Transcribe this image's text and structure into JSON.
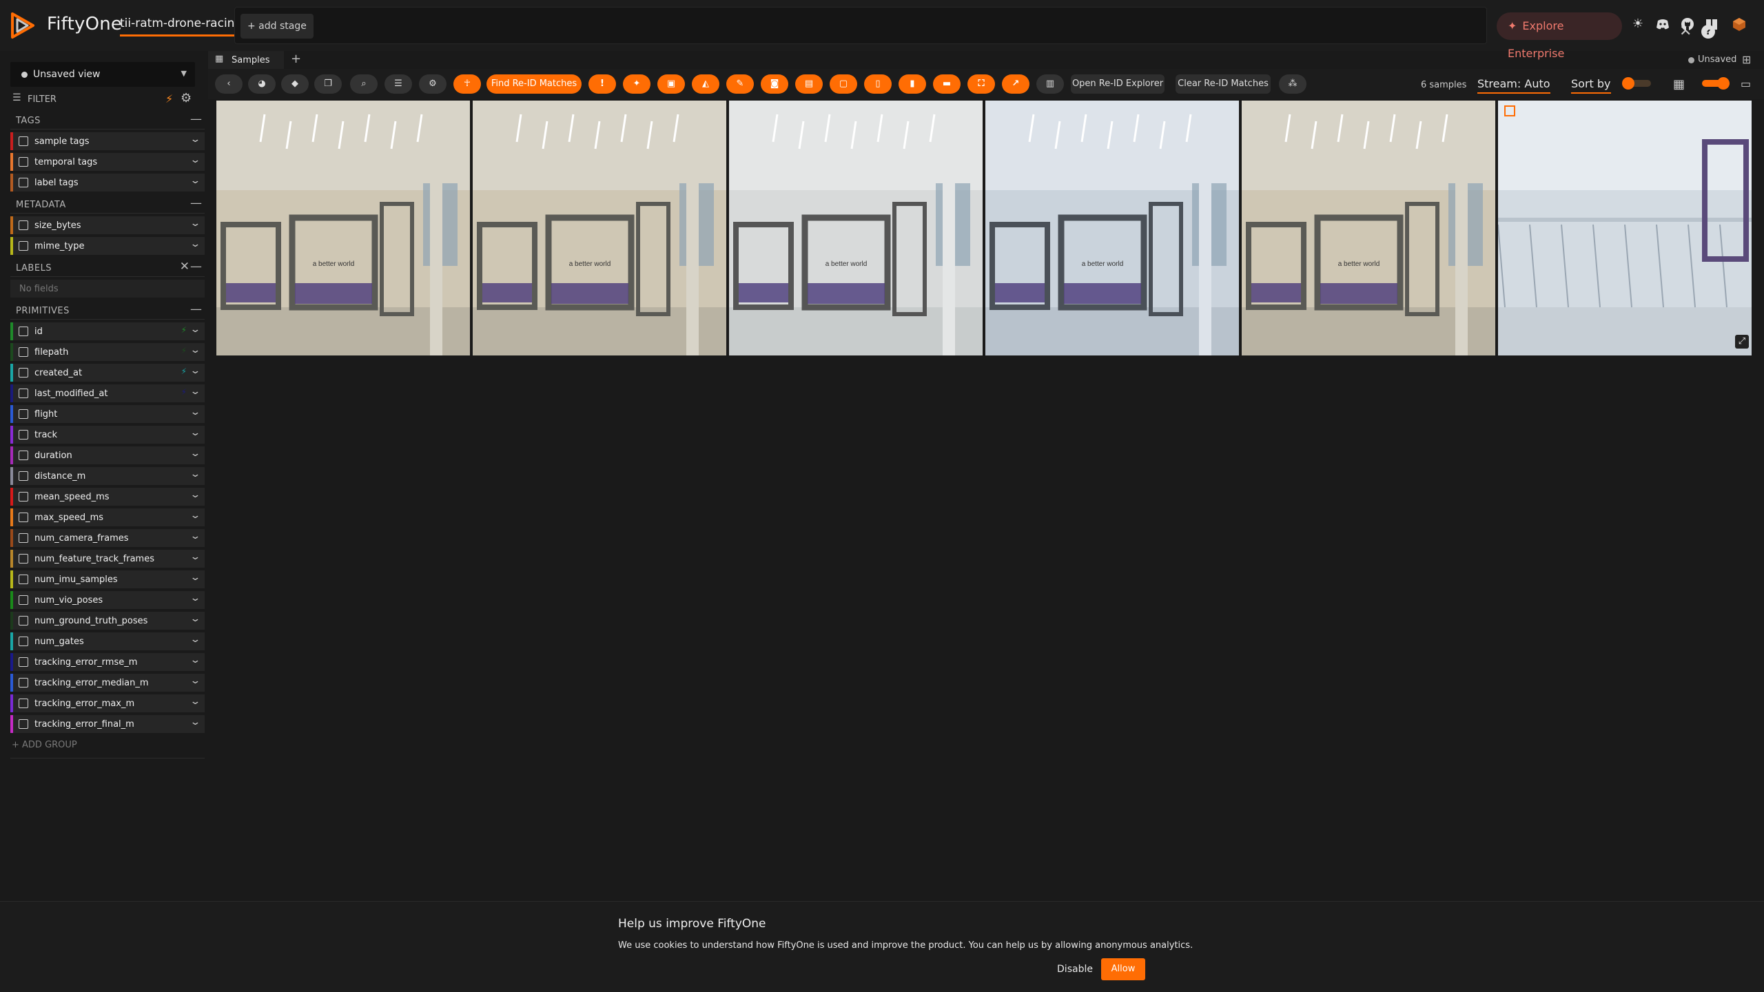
{
  "app": {
    "brand": "FiftyOne",
    "dataset_name": "tii-ratm-drone-racing",
    "add_stage": "+ add stage",
    "explore_enterprise": "Explore Enterprise",
    "accent_color": "#ff6d04"
  },
  "sidebar": {
    "view_select": "Unsaved view",
    "filter_label": "FILTER",
    "groups": {
      "tags": "TAGS",
      "metadata": "METADATA",
      "labels": "LABELS",
      "primitives": "PRIMITIVES"
    },
    "tags_fields": [
      {
        "label": "sample tags",
        "color": "#c81e1e"
      },
      {
        "label": "temporal tags",
        "color": "#e8772e"
      },
      {
        "label": "label tags",
        "color": "#b35b22"
      }
    ],
    "metadata_fields": [
      {
        "label": "size_bytes",
        "color": "#c06a1a"
      },
      {
        "label": "mime_type",
        "color": "#b8b81a"
      }
    ],
    "labels_empty": "No fields",
    "primitive_fields": [
      {
        "label": "id",
        "color": "#1f8a2a"
      },
      {
        "label": "filepath",
        "color": "#1d4a1f"
      },
      {
        "label": "created_at",
        "color": "#1aa6a6"
      },
      {
        "label": "last_modified_at",
        "color": "#1a1a7a"
      },
      {
        "label": "flight",
        "color": "#2a5ad6"
      },
      {
        "label": "track",
        "color": "#8a2ad6"
      },
      {
        "label": "duration",
        "color": "#a62ab8"
      },
      {
        "label": "distance_m",
        "color": "#8a8a9a"
      },
      {
        "label": "mean_speed_ms",
        "color": "#d61a1a"
      },
      {
        "label": "max_speed_ms",
        "color": "#e87a1a"
      },
      {
        "label": "num_camera_frames",
        "color": "#9a4a1a"
      },
      {
        "label": "num_feature_track_frames",
        "color": "#b8862a"
      },
      {
        "label": "num_imu_samples",
        "color": "#b8b81a"
      },
      {
        "label": "num_vio_poses",
        "color": "#1a8a1a"
      },
      {
        "label": "num_ground_truth_poses",
        "color": "#1d3a1d"
      },
      {
        "label": "num_gates",
        "color": "#1aa6a6"
      },
      {
        "label": "tracking_error_rmse_m",
        "color": "#1a1a8a"
      },
      {
        "label": "tracking_error_median_m",
        "color": "#2a5ad6"
      },
      {
        "label": "tracking_error_max_m",
        "color": "#7a2ad6"
      },
      {
        "label": "tracking_error_final_m",
        "color": "#c62ac6"
      }
    ],
    "add_group": "+ ADD GROUP"
  },
  "tabs": {
    "samples": "Samples",
    "unsaved": "Unsaved"
  },
  "toolbar": {
    "find_reid": "Find Re-ID Matches",
    "open_reid": "Open Re-ID Explorer",
    "clear_reid": "Clear Re-ID Matches",
    "sample_count": "6 samples",
    "stream": "Stream: Auto",
    "sort_by": "Sort by"
  },
  "grid": {
    "tiles": [
      {
        "name": "sample-tile-1",
        "tone": "warm"
      },
      {
        "name": "sample-tile-2",
        "tone": "warm"
      },
      {
        "name": "sample-tile-3",
        "tone": "neutral"
      },
      {
        "name": "sample-tile-4",
        "tone": "cool"
      },
      {
        "name": "sample-tile-5",
        "tone": "warm"
      },
      {
        "name": "sample-tile-6",
        "tone": "wall"
      }
    ],
    "gate_text": "a better world"
  },
  "cookie": {
    "title": "Help us improve FiftyOne",
    "text": "We use cookies to understand how FiftyOne is used and improve the product. You can help us by allowing anonymous analytics.",
    "disable": "Disable",
    "allow": "Allow"
  }
}
